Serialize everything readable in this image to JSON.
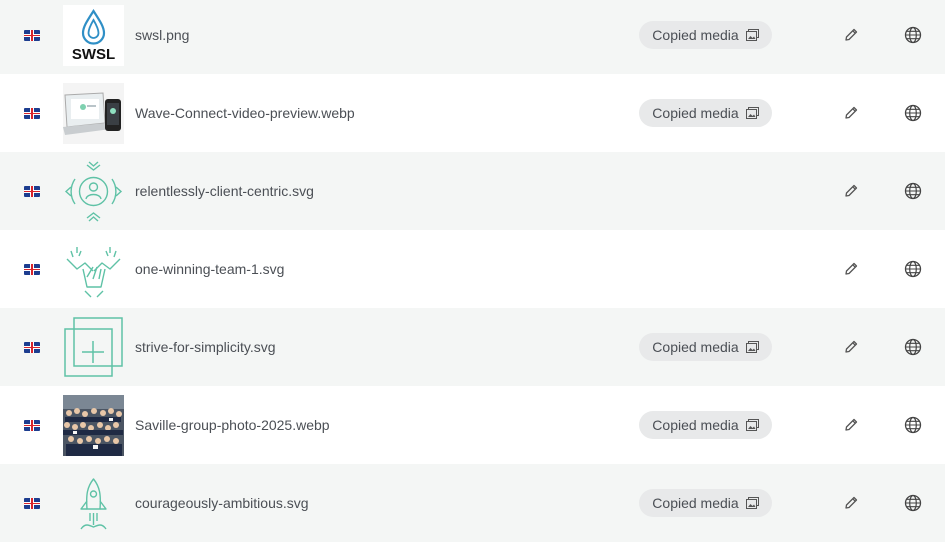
{
  "colors": {
    "accent_green": "#5fc2a6",
    "badge_bg": "#e8e9ea",
    "row_alt_bg": "#f4f6f5",
    "text": "#4b4f55"
  },
  "rows": [
    {
      "flag": "uk-flag-icon",
      "thumb": "swsl-logo",
      "thumb_text": "SWSL",
      "filename": "swsl.png",
      "badge": "Copied media",
      "badge_icon": "image-icon"
    },
    {
      "flag": "uk-flag-icon",
      "thumb": "laptop-phone-preview",
      "filename": "Wave-Connect-video-preview.webp",
      "badge": "Copied media",
      "badge_icon": "image-icon"
    },
    {
      "flag": "uk-flag-icon",
      "thumb": "client-centric-icon",
      "filename": "relentlessly-client-centric.svg",
      "badge": ""
    },
    {
      "flag": "uk-flag-icon",
      "thumb": "team-hands-icon",
      "filename": "one-winning-team-1.svg",
      "badge": ""
    },
    {
      "flag": "uk-flag-icon",
      "thumb": "simplicity-squares-icon",
      "filename": "strive-for-simplicity.svg",
      "badge": "Copied media",
      "badge_icon": "image-icon"
    },
    {
      "flag": "uk-flag-icon",
      "thumb": "group-photo",
      "filename": "Saville-group-photo-2025.webp",
      "badge": "Copied media",
      "badge_icon": "image-icon"
    },
    {
      "flag": "uk-flag-icon",
      "thumb": "rocket-icon",
      "filename": "courageously-ambitious.svg",
      "badge": "Copied media",
      "badge_icon": "image-icon"
    }
  ]
}
